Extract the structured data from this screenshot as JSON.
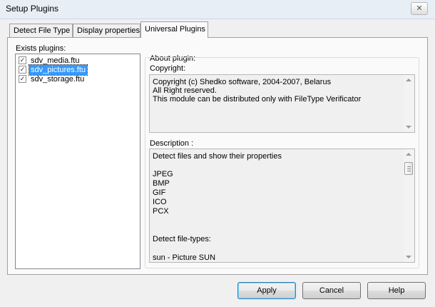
{
  "window": {
    "title": "Setup Plugins",
    "close_glyph": "✕"
  },
  "tabs": [
    {
      "label": "Detect File Type",
      "active": false
    },
    {
      "label": "Display properties",
      "active": false
    },
    {
      "label": "Universal Plugins",
      "active": true
    }
  ],
  "plugins": {
    "header": "Exists plugins:",
    "items": [
      {
        "name": "sdv_media.ftu",
        "checked": true,
        "selected": false
      },
      {
        "name": "sdv_pictures.ftu",
        "checked": true,
        "selected": true
      },
      {
        "name": "sdv_storage.ftu",
        "checked": true,
        "selected": false
      }
    ],
    "check_glyph": "✓"
  },
  "about": {
    "header": "About plugin:",
    "copyright_label": "Copyright:",
    "copyright_lines": [
      "Copyright (c) Shedko software, 2004-2007, Belarus",
      "All Right reserved.",
      "This module can be distributed only with FileType Verificator"
    ],
    "description_label": "Description :",
    "description_lines": [
      "Detect files and show their properties",
      "",
      "JPEG",
      "BMP",
      "GIF",
      "ICO",
      "PCX",
      "",
      "",
      "Detect file-types:",
      "",
      "sun - Picture SUN"
    ]
  },
  "buttons": {
    "apply": "Apply",
    "cancel": "Cancel",
    "help": "Help"
  },
  "colors": {
    "selection": "#3399ff",
    "default_button_border": "#3c7fb1"
  }
}
